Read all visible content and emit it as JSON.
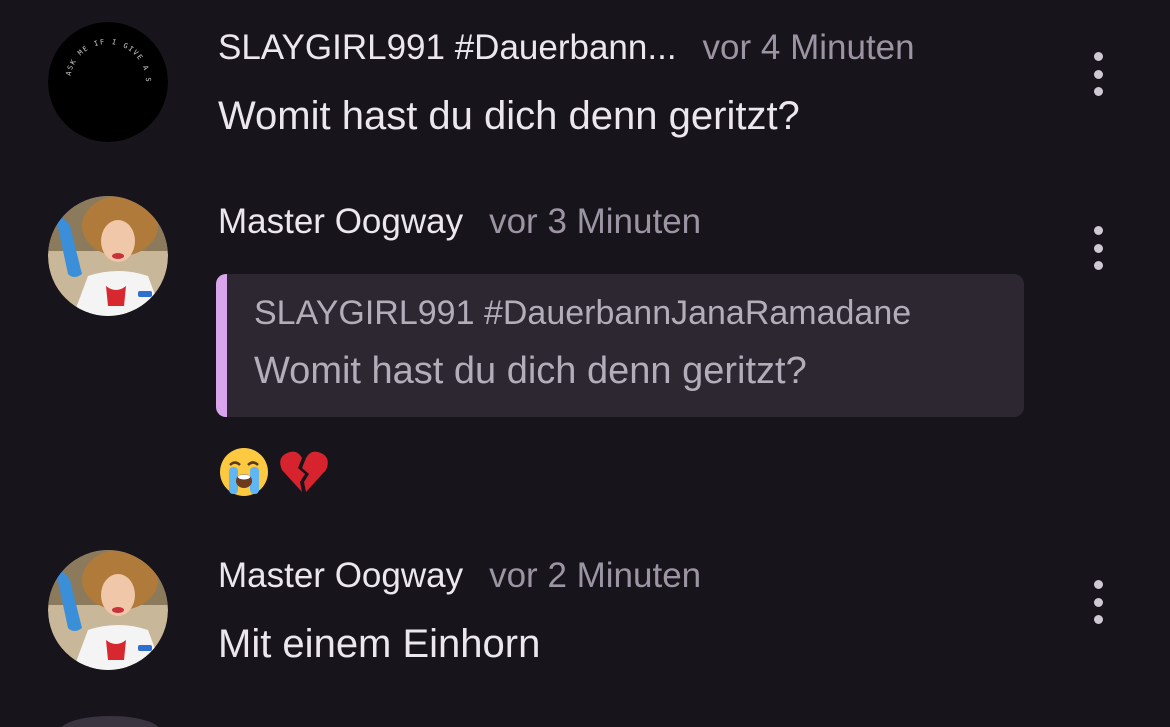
{
  "comments": [
    {
      "username": "SLAYGIRL991 #Dauerbann...",
      "time": "vor 4 Minuten",
      "text": "Womit hast du dich denn geritzt?",
      "avatar_text": "ASK ME IF I GIVE A SHIT",
      "avatar_icon": "black-circle-text-avatar"
    },
    {
      "username": "Master Oogway",
      "time": "vor 3 Minuten",
      "quote": {
        "username": "SLAYGIRL991 #DauerbannJanaRamadane",
        "text": "Womit hast du dich denn geritzt?"
      },
      "emojis": [
        "loudly-crying-face-icon",
        "broken-heart-icon"
      ],
      "avatar_icon": "nurse-photo-avatar"
    },
    {
      "username": "Master Oogway",
      "time": "vor 2 Minuten",
      "text": "Mit einem Einhorn",
      "avatar_icon": "nurse-photo-avatar"
    }
  ],
  "colors": {
    "background": "#18141b",
    "username": "#ece7ef",
    "timestamp": "#9c94a3",
    "quote_background": "#2c2731",
    "quote_accent": "#d9a5ec"
  }
}
